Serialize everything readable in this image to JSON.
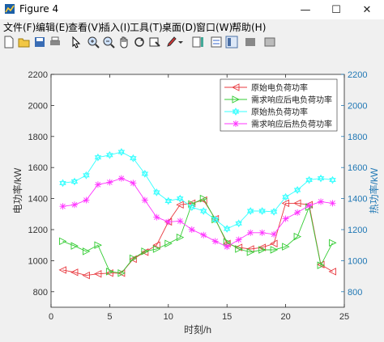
{
  "window": {
    "title": "Figure 4",
    "controls": {
      "minimize": "—",
      "maximize": "☐",
      "close": "✕"
    }
  },
  "menu": [
    "文件(F)",
    "编辑(E)",
    "查看(V)",
    "插入(I)",
    "工具(T)",
    "桌面(D)",
    "窗口(W)",
    "帮助(H)"
  ],
  "toolbar_icons": [
    "new-figure-icon",
    "open-icon",
    "save-icon",
    "print-icon",
    "pointer-icon",
    "zoom-in-icon",
    "zoom-out-icon",
    "pan-icon",
    "rotate-icon",
    "data-cursor-icon",
    "brush-icon",
    "colorbar-icon",
    "legend-icon",
    "plot-tools-hide-icon",
    "plot-tools-show-icon"
  ],
  "colors": {
    "left_axis": "#333333",
    "right_axis": "#1f77b4",
    "red": "#e8393f",
    "green": "#33cc33",
    "cyan": "#33ffff",
    "magenta": "#ff33ff"
  },
  "chart_data": {
    "type": "line",
    "xlabel": "时刻/h",
    "ylabel_left": "电功率/kW",
    "ylabel_right": "热功率/kW",
    "xlim": [
      0,
      25
    ],
    "ylim_left": [
      700,
      2200
    ],
    "ylim_right": [
      700,
      2200
    ],
    "xticks": [
      0,
      5,
      10,
      15,
      20,
      25
    ],
    "yticks_left": [
      800,
      1000,
      1200,
      1400,
      1600,
      1800,
      2000,
      2200
    ],
    "yticks_right": [
      800,
      1000,
      1200,
      1400,
      1600,
      1800,
      2000,
      2200
    ],
    "x": [
      1,
      2,
      3,
      4,
      5,
      6,
      7,
      8,
      9,
      10,
      11,
      12,
      13,
      14,
      15,
      16,
      17,
      18,
      19,
      20,
      21,
      22,
      23,
      24
    ],
    "legend_position": "top-right",
    "series": [
      {
        "name": "原始电负荷功率",
        "axis": "left",
        "marker": "triangle-left",
        "color": "#e8393f",
        "values": [
          940,
          925,
          905,
          915,
          920,
          920,
          1010,
          1055,
          1100,
          1250,
          1360,
          1370,
          1390,
          1270,
          1110,
          1085,
          1075,
          1085,
          1110,
          1370,
          1370,
          1360,
          975,
          930
        ]
      },
      {
        "name": "需求响应后电负荷功率",
        "axis": "left",
        "marker": "triangle-right",
        "color": "#33cc33",
        "values": [
          1125,
          1095,
          1060,
          1100,
          930,
          920,
          1015,
          1060,
          1075,
          1110,
          1150,
          1365,
          1400,
          1265,
          1120,
          1075,
          1055,
          1070,
          1070,
          1090,
          1155,
          1345,
          970,
          1115
        ]
      },
      {
        "name": "原始热负荷功率",
        "axis": "right",
        "marker": "hexagram",
        "color": "#33ffff",
        "values": [
          1500,
          1510,
          1550,
          1665,
          1680,
          1700,
          1660,
          1560,
          1440,
          1385,
          1400,
          1345,
          1320,
          1265,
          1205,
          1240,
          1320,
          1320,
          1315,
          1410,
          1455,
          1520,
          1530,
          1520
        ]
      },
      {
        "name": "需求响应后热负荷功率",
        "axis": "right",
        "marker": "star",
        "color": "#ff33ff",
        "values": [
          1350,
          1360,
          1390,
          1490,
          1505,
          1530,
          1500,
          1390,
          1280,
          1250,
          1255,
          1200,
          1165,
          1125,
          1090,
          1135,
          1180,
          1180,
          1170,
          1270,
          1310,
          1355,
          1380,
          1370
        ]
      }
    ]
  }
}
